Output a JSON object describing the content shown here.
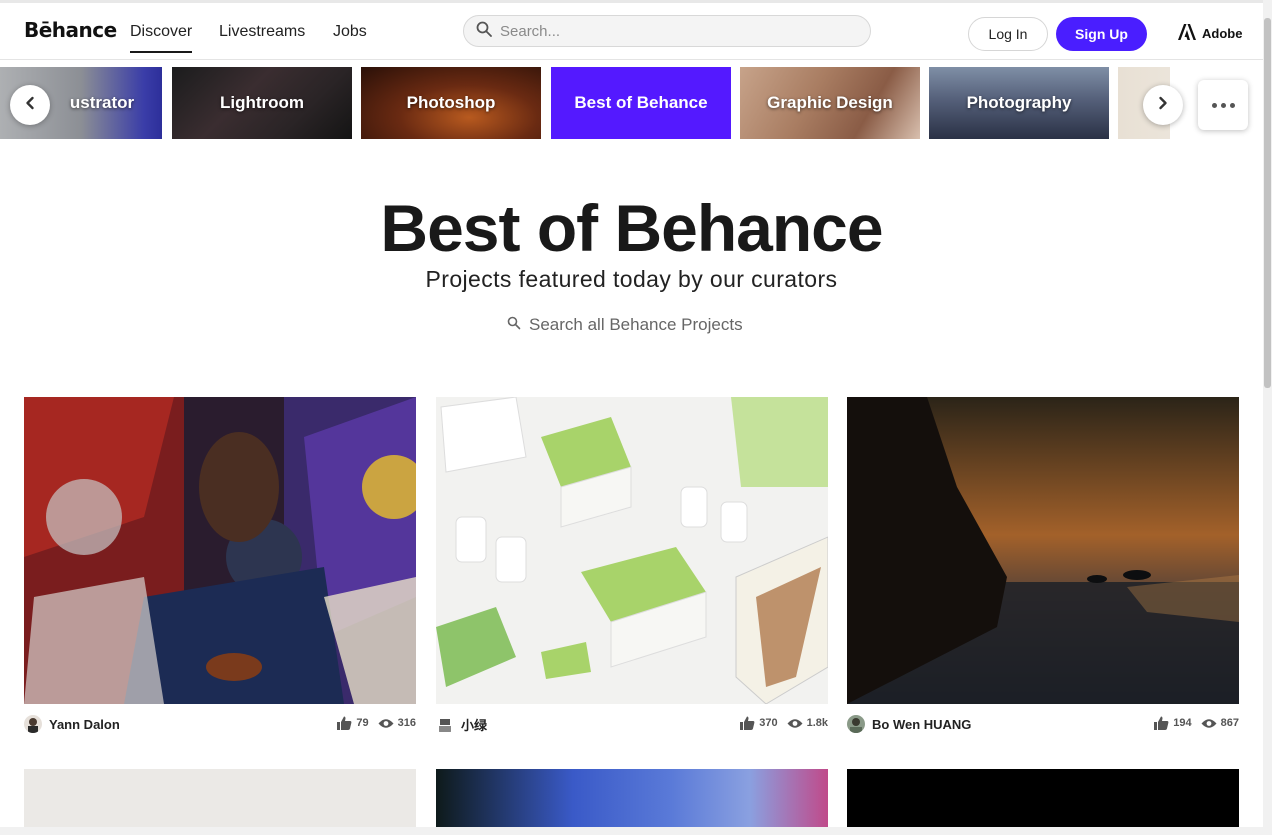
{
  "header": {
    "logo": "Bēhance",
    "nav": [
      "Discover",
      "Livestreams",
      "Jobs"
    ],
    "search_placeholder": "Search...",
    "login_label": "Log In",
    "signup_label": "Sign Up",
    "adobe_label": "Adobe",
    "accent_color": "#4a1eff"
  },
  "categories": [
    {
      "label": "Illustrator",
      "visible_text": "ustrator"
    },
    {
      "label": "Lightroom"
    },
    {
      "label": "Photoshop"
    },
    {
      "label": "Best of Behance",
      "active": true
    },
    {
      "label": "Graphic Design"
    },
    {
      "label": "Photography"
    },
    {
      "label": ""
    }
  ],
  "carousel_controls": {
    "prev_icon": "chevron-left-icon",
    "next_icon": "chevron-right-icon",
    "more_icon": "more-dots-icon"
  },
  "hero": {
    "title": "Best of Behance",
    "subtitle": "Projects featured today by our curators",
    "search_label": "Search all Behance Projects"
  },
  "projects": [
    {
      "owner": "Yann Dalon",
      "likes": "79",
      "views": "316"
    },
    {
      "owner": "小绿",
      "likes": "370",
      "views": "1.8k"
    },
    {
      "owner": "Bo Wen HUANG",
      "likes": "194",
      "views": "867"
    }
  ]
}
